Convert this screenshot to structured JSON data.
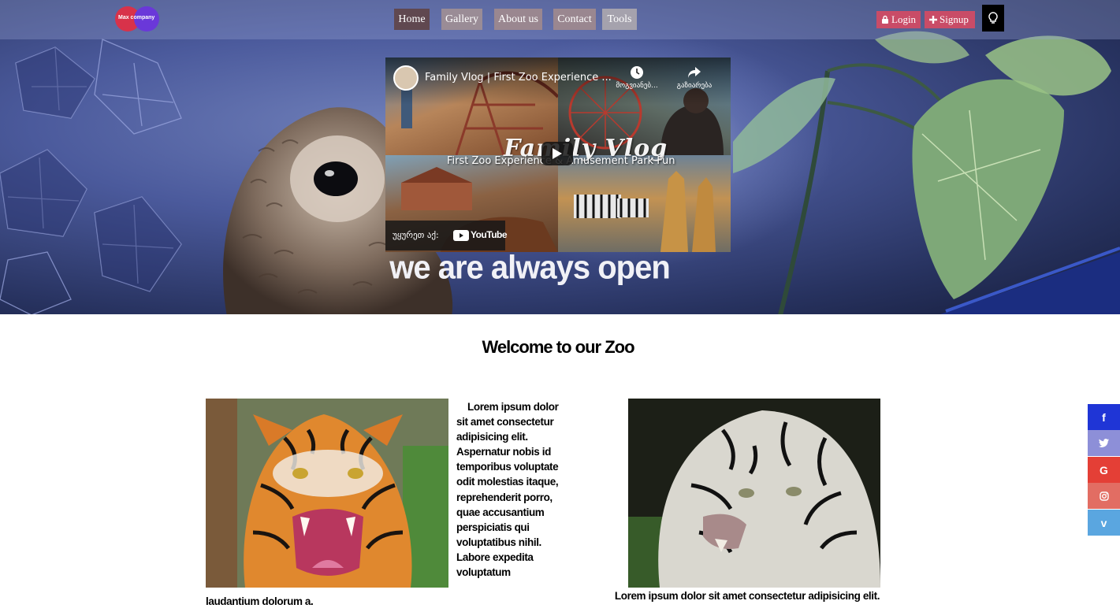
{
  "brand": {
    "logo_text": "Max company"
  },
  "nav": {
    "items": [
      {
        "label": "Home"
      },
      {
        "label": "Gallery"
      },
      {
        "label": "About us"
      },
      {
        "label": "Contact"
      },
      {
        "label": "Tools"
      }
    ],
    "login_label": "Login",
    "signup_label": "Signup"
  },
  "video": {
    "title": "Family Vlog | First Zoo Experience ...",
    "watch_later_label": "მოგვიანებ...",
    "share_label": "გაზიარება",
    "thumb_brand": "Family Vlog",
    "thumb_subtitle": "First Zoo Experience & Amusement Park Fun",
    "watch_on_label": "უყურეთ აქ:",
    "youtube_label": "YouTube"
  },
  "hero": {
    "caption": "we are always open"
  },
  "content": {
    "welcome_title": "Welcome to our Zoo",
    "paragraph": "Lorem ipsum dolor sit amet consectetur adipisicing elit. Aspernatur nobis id temporibus voluptate odit molestias itaque, reprehenderit porro, quae accusantium perspiciatis qui voluptatibus nihil. Labore expedita voluptatum",
    "paragraph_tail": "laudantium dolorum a.",
    "caption2": "Lorem ipsum dolor sit amet consectetur adipisicing elit."
  },
  "social": [
    {
      "icon": "facebook-icon",
      "glyph": "f",
      "color": "#1f35d6"
    },
    {
      "icon": "twitter-icon",
      "color": "#8d8fd8"
    },
    {
      "icon": "google-icon",
      "glyph": "G",
      "color": "#e43f36"
    },
    {
      "icon": "instagram-icon",
      "color": "#e26d63"
    },
    {
      "icon": "vimeo-icon",
      "glyph": "v",
      "color": "#5aa6e0"
    }
  ]
}
